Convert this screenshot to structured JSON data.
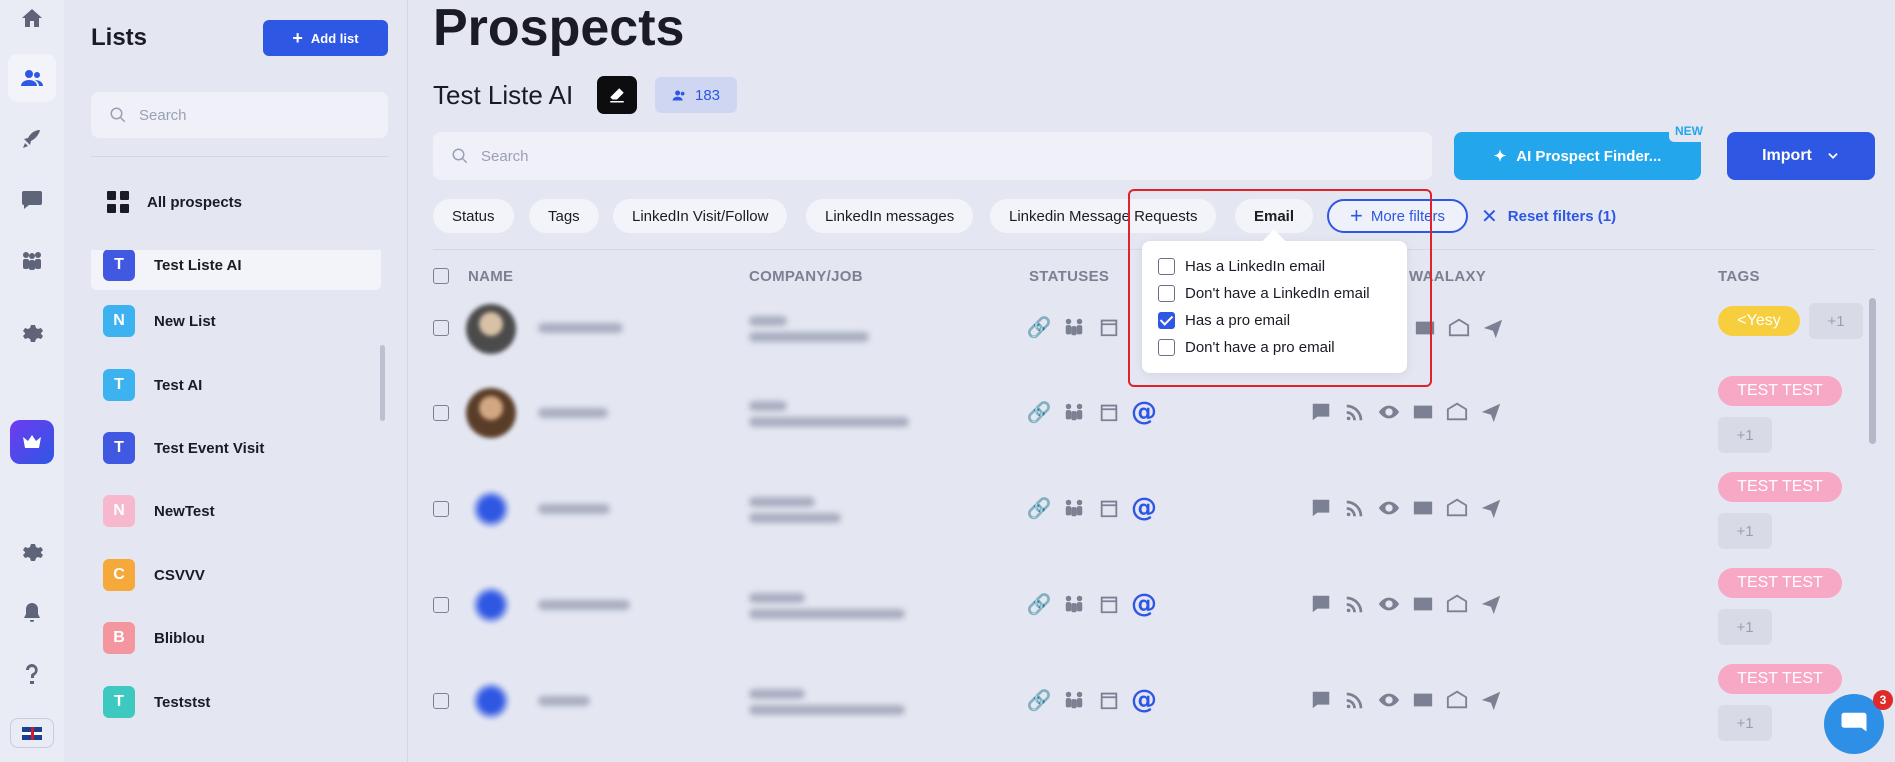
{
  "sidebar": {
    "rail_icons": [
      "home-icon",
      "users-icon",
      "rocket-icon",
      "chat-icon",
      "team-icon",
      "settings-icon",
      "crown-icon",
      "gear-icon",
      "bell-icon",
      "help-icon"
    ],
    "language": "en-GB"
  },
  "lists_panel": {
    "title": "Lists",
    "add_label": "Add list",
    "search_placeholder": "Search",
    "all_prospects": "All prospects",
    "items": [
      {
        "initial": "T",
        "label": "Test Liste AI",
        "color": "#4159e0",
        "selected": true
      },
      {
        "initial": "N",
        "label": "New List",
        "color": "#3db2f1"
      },
      {
        "initial": "T",
        "label": "Test AI",
        "color": "#3db2f1"
      },
      {
        "initial": "T",
        "label": "Test Event Visit",
        "color": "#4159e0"
      },
      {
        "initial": "N",
        "label": "NewTest",
        "color": "#f7b7cd"
      },
      {
        "initial": "C",
        "label": "CSVVV",
        "color": "#f4a93a"
      },
      {
        "initial": "B",
        "label": "Bliblou",
        "color": "#f496a0"
      },
      {
        "initial": "T",
        "label": "Teststst",
        "color": "#3dc9c0"
      }
    ]
  },
  "main": {
    "title": "Prospects",
    "list_name": "Test Liste AI",
    "prospect_count": "183",
    "search_placeholder": "Search",
    "ai_button": "AI Prospect Finder...",
    "new_tag": "NEW",
    "import_button": "Import",
    "filters": [
      "Status",
      "Tags",
      "LinkedIn Visit/Follow",
      "LinkedIn messages",
      "Linkedin Message Requests",
      "Email"
    ],
    "more_filters": "More filters",
    "reset_filters": "Reset filters (1)",
    "columns": {
      "name": "NAME",
      "company": "COMPANY/JOB",
      "statuses": "STATUSES",
      "waalaxy": "WAALAXY",
      "tags": "TAGS"
    },
    "email_dropdown": {
      "options": [
        {
          "label": "Has a LinkedIn email",
          "checked": false
        },
        {
          "label": "Don't have a LinkedIn email",
          "checked": false
        },
        {
          "label": "Has a pro email",
          "checked": true
        },
        {
          "label": "Don't have a pro email",
          "checked": false
        }
      ]
    },
    "rows": [
      {
        "tag": "<Yesy",
        "tag_color": "#f7ce3e",
        "extra": "+1"
      },
      {
        "tag": "TEST TEST",
        "tag_color": "#f7a8c4",
        "extra": "+1"
      },
      {
        "tag": "TEST TEST",
        "tag_color": "#f7a8c4",
        "extra": "+1"
      },
      {
        "tag": "TEST TEST",
        "tag_color": "#f7a8c4",
        "extra": "+1"
      },
      {
        "tag": "TEST TEST",
        "tag_color": "#f7a8c4",
        "extra": "+1"
      }
    ]
  },
  "chat": {
    "badge": "3"
  },
  "colors": {
    "accent": "#2e57e4",
    "ai": "#23a6ec",
    "highlight": "#e0222c"
  }
}
